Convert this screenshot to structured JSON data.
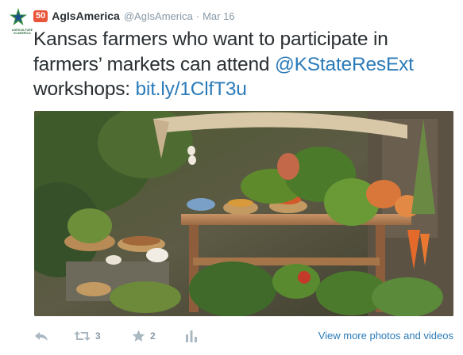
{
  "author": {
    "avatar_caption": "AGRICULTURE IN AMERICA",
    "badge": "50",
    "name": "AgIsAmerica",
    "handle": "@AgIsAmerica",
    "separator": "·",
    "date": "Mar 16"
  },
  "tweet": {
    "text_before": "Kansas farmers who want to participate in farmers’ markets can attend ",
    "mention": "@KStateResExt",
    "text_middle": " workshops: ",
    "url": "bit.ly/1ClfT3u"
  },
  "actions": {
    "reply_icon": "reply-icon",
    "retweet_icon": "retweet-icon",
    "retweet_count": "3",
    "favorite_icon": "star-icon",
    "favorite_count": "2",
    "stats_icon": "bar-chart-icon",
    "view_more": "View more photos and videos"
  },
  "colors": {
    "link": "#2b7bb9",
    "badge": "#e8553a",
    "text": "#292f33",
    "muted": "#8899a6"
  }
}
